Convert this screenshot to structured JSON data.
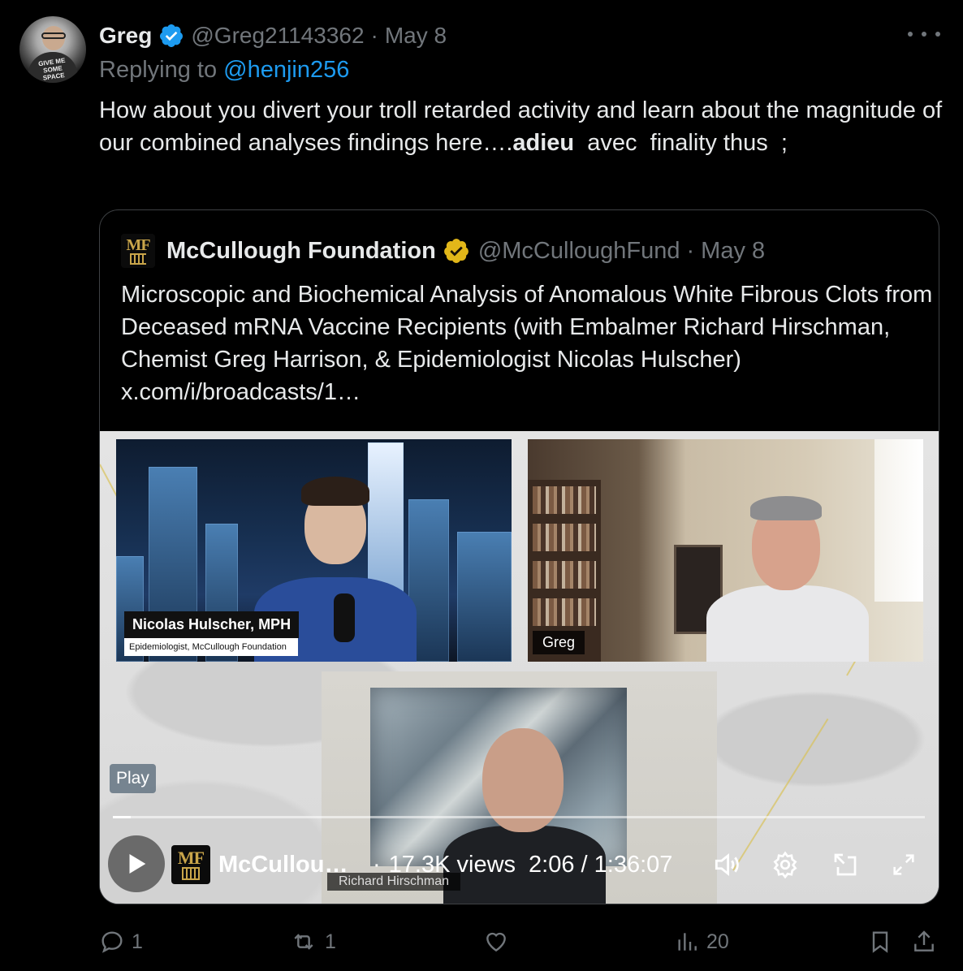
{
  "author": {
    "name": "Greg",
    "handle": "@Greg21143362",
    "date": "May 8",
    "avatar_text": "GIVE ME SOME SPACE"
  },
  "reply": {
    "prefix": "Replying to",
    "mention": "@henjin256"
  },
  "tweet": {
    "text_part1": "How about you divert your troll retarded activity and learn about the magnitude of our combined analyses findings here….",
    "bold": "adieu",
    "text_part2": "  avec  finality thus  ;"
  },
  "quote": {
    "name": "McCullough Foundation",
    "handle": "@McCulloughFund",
    "date": "May 8",
    "logo_text": "MF",
    "text": "Microscopic and Biochemical Analysis of Anomalous White Fibrous Clots from Deceased mRNA Vaccine Recipients (with Embalmer Richard Hirschman, Chemist Greg Harrison, & Epidemiologist Nicolas Hulscher) x.com/i/broadcasts/1…"
  },
  "video": {
    "lower_third_name": "Nicolas Hulscher, MPH",
    "lower_third_title": "Epidemiologist, McCullough Foundation",
    "greg_label": "Greg",
    "richard_label": "Richard Hirschman",
    "play_tag": "Play",
    "progress": 0.022,
    "channel": "McCullou…",
    "views": "17.3K views",
    "time": "2:06 / 1:36:07"
  },
  "actions": {
    "replies": "1",
    "reposts": "1",
    "views": "20"
  },
  "colors": {
    "background": "#000000",
    "text": "#e7e9ea",
    "muted": "#71767b",
    "link": "#1d9bf0",
    "verified_blue": "#1d9bf0",
    "verified_gold": "#e2b719"
  },
  "icons": [
    "more-icon",
    "verified-icon",
    "play-icon",
    "volume-icon",
    "settings-icon",
    "dock-icon",
    "fullscreen-icon",
    "reply-icon",
    "repost-icon",
    "like-icon",
    "views-icon",
    "bookmark-icon",
    "share-icon"
  ]
}
